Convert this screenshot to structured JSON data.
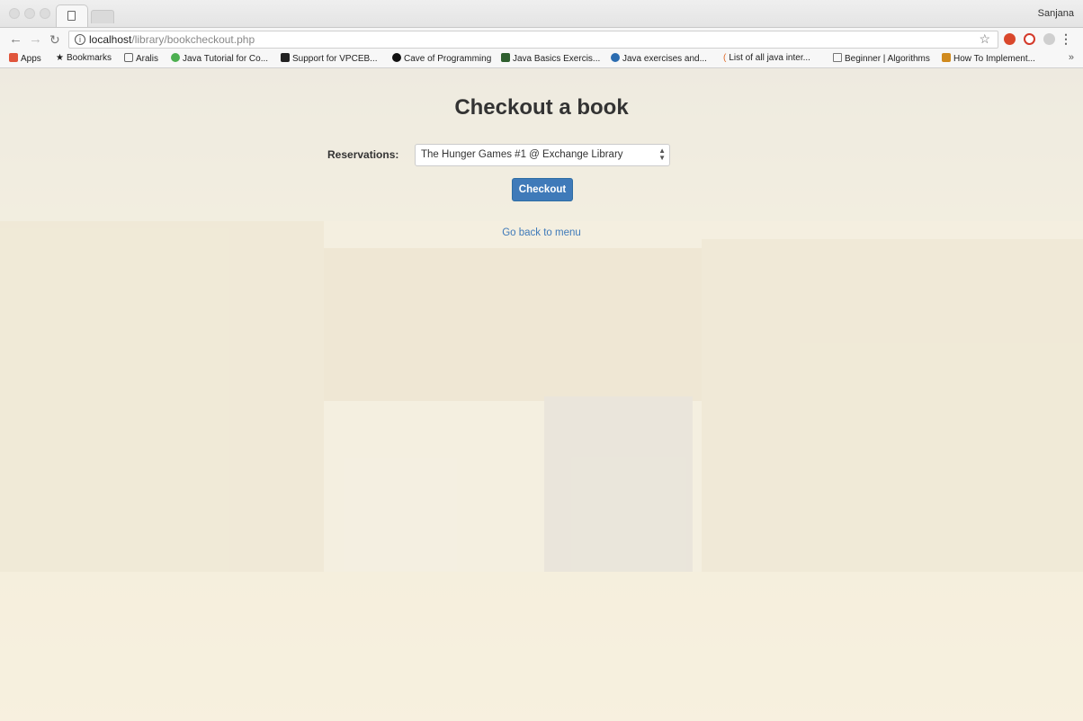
{
  "browser": {
    "user_name": "Sanjana",
    "url_host": "localhost",
    "url_path": "/library/bookcheckout.php",
    "bookmarks": [
      {
        "label": "Apps",
        "icon": "apps-grid-icon",
        "color": "#e0553c"
      },
      {
        "label": "Bookmarks",
        "icon": "star-icon",
        "color": "#555555"
      },
      {
        "label": "Aralis",
        "icon": "folder-icon",
        "color": "#777777"
      },
      {
        "label": "Java Tutorial for Co...",
        "icon": "udemy-icon",
        "color": "#4caf50"
      },
      {
        "label": "Support for VPCEB...",
        "icon": "sony-icon",
        "color": "#222222"
      },
      {
        "label": "Cave of Programming",
        "icon": "yin-yang-icon",
        "color": "#111111"
      },
      {
        "label": "Java Basics Exercis...",
        "icon": "exercises-icon",
        "color": "#2f5f2f"
      },
      {
        "label": "Java exercises and...",
        "icon": "globe-icon",
        "color": "#2b6cb0"
      },
      {
        "label": "List of all java inter...",
        "icon": "flame-icon",
        "color": "#e06b2b"
      },
      {
        "label": "Beginner | Algorithms",
        "icon": "page-icon",
        "color": "#777777"
      },
      {
        "label": "How To Implement...",
        "icon": "hackerearth-icon",
        "color": "#d08a1e"
      }
    ]
  },
  "page": {
    "title": "Checkout a book",
    "reservations_label": "Reservations:",
    "selected_reservation": "The Hunger Games #1 @ Exchange Library",
    "checkout_label": "Checkout",
    "back_link": "Go back to menu"
  },
  "colors": {
    "primary": "#3f7ab9",
    "title_text": "#333333"
  }
}
